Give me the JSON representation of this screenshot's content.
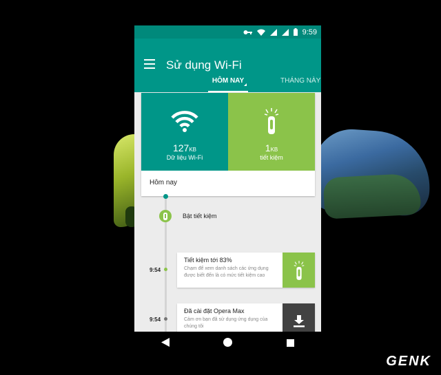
{
  "statusbar": {
    "time": "9:59"
  },
  "app": {
    "title": "Sử dụng Wi-Fi"
  },
  "tabs": [
    {
      "label": "HÔM NAY",
      "active": true
    },
    {
      "label": "THÁNG NÀY",
      "active": false
    }
  ],
  "summary": {
    "wifi": {
      "value": "127",
      "unit": "KB",
      "label": "Dữ liệu Wi-Fi",
      "icon": "wifi-icon",
      "color": "#009688"
    },
    "saved": {
      "value": "1",
      "unit": "KB",
      "label": "tiết kiệm",
      "icon": "saving-icon",
      "color": "#8bc34a"
    },
    "date": "Hôm nay"
  },
  "timeline": {
    "start_event": "Bật tiết kiệm",
    "items": [
      {
        "time": "9:54",
        "title": "Tiết kiệm tới 83%",
        "desc": "Chạm để xem danh sách các ứng dụng được biết đến là có mức tiết kiệm cao",
        "icon": "saving-icon",
        "color": "#8bc34a"
      },
      {
        "time": "9:54",
        "title": "Đã cài đặt Opera Max",
        "desc": "Cảm ơn bạn đã sử dụng ứng dụng của chúng tôi",
        "icon": "download-icon",
        "color": "#424242"
      }
    ]
  },
  "watermark": "GENK"
}
